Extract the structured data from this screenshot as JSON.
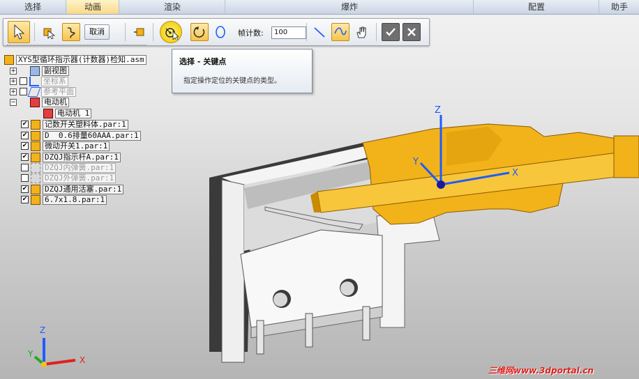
{
  "ribbon": {
    "tabs": [
      {
        "label": "选择"
      },
      {
        "label": "动画"
      },
      {
        "label": "渲染"
      },
      {
        "label": "爆炸"
      },
      {
        "label": "配置"
      },
      {
        "label": "助手"
      }
    ]
  },
  "command_bar": {
    "cancel_label": "取消",
    "frame_count_label": "帧计数:",
    "frame_count_value": "100"
  },
  "tooltip": {
    "title": "选择 - 关键点",
    "body": "指定操作定位的关键点的类型。"
  },
  "tree": {
    "root": "XYS型循环指示器(计数器)检知.asm",
    "items": [
      {
        "label": "副视图"
      },
      {
        "label": "坐标系"
      },
      {
        "label": "参考平面"
      },
      {
        "label": "电动机"
      },
      {
        "label": "电动机 1"
      },
      {
        "label": "记数开关塑料体.par:1"
      },
      {
        "label": "D  0.6排量60AAA.par:1"
      },
      {
        "label": "微动开关1.par:1"
      },
      {
        "label": "DZQJ指示杆A.par:1"
      },
      {
        "label": "DZQJ内弹簧.par:1"
      },
      {
        "label": "DZQJ外弹簧.par:1"
      },
      {
        "label": "DZQJ通用活塞.par:1"
      },
      {
        "label": "6.7x1.8.par:1"
      }
    ]
  },
  "triad": {
    "x": "X",
    "y": "Y",
    "z": "Z"
  },
  "model_axes": {
    "x": "X",
    "y": "Y",
    "z": "Z"
  },
  "watermark": "三维网www.3dportal.cn",
  "colors": {
    "accent": "#f6c44c",
    "part_gold": "#f2b21a",
    "housing": "#3d3d3d"
  }
}
